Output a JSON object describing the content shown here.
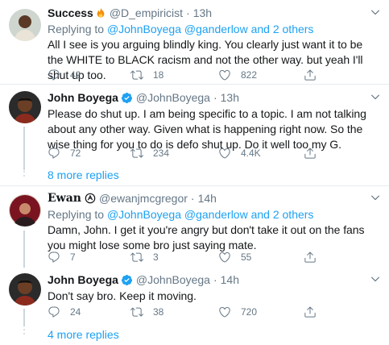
{
  "replying_prefix": "Replying to ",
  "replying_and": " and ",
  "tweets": [
    {
      "name": "Success",
      "handle": "@D_empiricist",
      "sep": "·",
      "time": "13h",
      "reply_to": [
        "@JohnBoyega",
        "@ganderlow",
        "2 others"
      ],
      "text": "All I see is you arguing blindly king. You clearly just want it to be the WHITE to BLACK racism and not the other way. but yeah I'll shut up too.",
      "replies": "42",
      "retweets": "18",
      "likes": "822"
    },
    {
      "name": "John Boyega",
      "handle": "@JohnBoyega",
      "sep": "·",
      "time": "13h",
      "text": "Please do shut up. I am being specific to a topic. I am not talking about any other way. Given what is happening right now. So the wise thing for you to do is defo shut up. Do it well too my G.",
      "replies": "72",
      "retweets": "234",
      "likes": "4.4K"
    },
    {
      "name": "Ewan",
      "handle": "@ewanjmcgregor",
      "sep": "·",
      "time": "14h",
      "reply_to": [
        "@JohnBoyega",
        "@ganderlow",
        "2 others"
      ],
      "text": "Damn, John. I get it you're angry but don't take it out on the fans you might lose some bro just saying mate.",
      "replies": "7",
      "retweets": "3",
      "likes": "55"
    },
    {
      "name": "John Boyega",
      "handle": "@JohnBoyega",
      "sep": "·",
      "time": "14h",
      "text": "Don't say bro. Keep it moving.",
      "replies": "24",
      "retweets": "38",
      "likes": "720"
    }
  ],
  "more_replies": [
    "8 more replies",
    "4 more replies"
  ],
  "colors": {
    "link": "#1da1f2",
    "secondary": "#657786",
    "text": "#14171a",
    "divider": "#e6ecf0",
    "verified": "#1da1f2"
  },
  "icons": [
    "fire-emoji-icon",
    "verified-badge-icon",
    "chevron-down-icon",
    "reply-icon",
    "retweet-icon",
    "like-icon",
    "share-icon"
  ]
}
